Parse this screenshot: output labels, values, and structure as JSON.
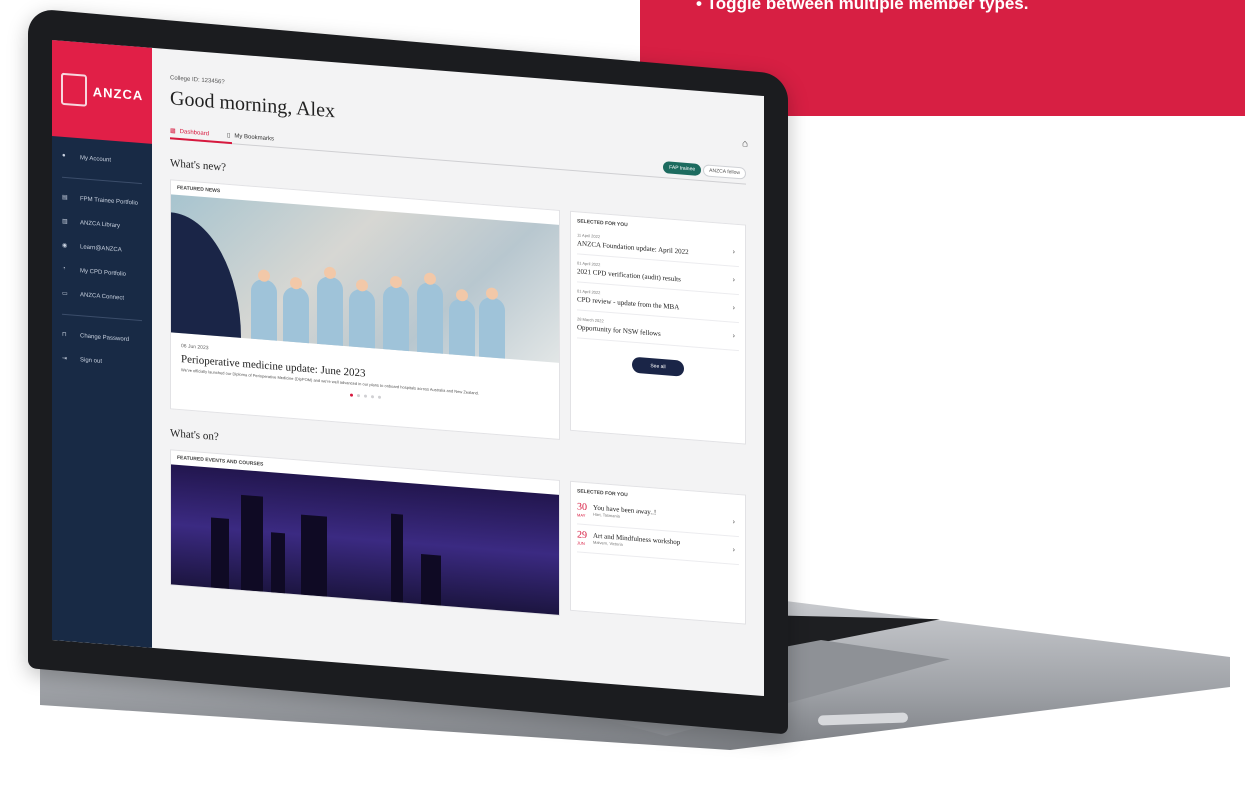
{
  "banner": {
    "bullet": "• Toggle between multiple member types."
  },
  "sidebar": {
    "brand": "ANZCA",
    "items": [
      {
        "label": "My Account",
        "icon": "user-icon"
      },
      {
        "label": "FPM Trainee Portfolio",
        "icon": "portfolio-icon"
      },
      {
        "label": "ANZCA Library",
        "icon": "library-icon"
      },
      {
        "label": "Learn@ANZCA",
        "icon": "learn-icon"
      },
      {
        "label": "My CPD Portfolio",
        "icon": "cpd-icon"
      },
      {
        "label": "ANZCA Connect",
        "icon": "connect-icon"
      },
      {
        "label": "Change Password",
        "icon": "lock-icon"
      },
      {
        "label": "Sign out",
        "icon": "signout-icon"
      }
    ]
  },
  "header": {
    "college_id": "College ID: 123456?",
    "greeting": "Good morning, Alex",
    "tabs": [
      {
        "label": "Dashboard"
      },
      {
        "label": "My Bookmarks"
      }
    ],
    "toggle": [
      "FAP trainee",
      "ANZCA fellow"
    ]
  },
  "whats_new": {
    "title": "What's new?",
    "featured_label": "FEATURED NEWS",
    "news": {
      "date": "06 Jun 2023",
      "title": "Perioperative medicine update: June 2023",
      "body": "We've officially launched our Diploma of Perioperative Medicine (DipPOM) and we're well advanced in our plans to onboard hospitals across Australia and New Zealand."
    },
    "selected_label": "SELECTED FOR YOU",
    "list": [
      {
        "date": "11 April 2022",
        "title": "ANZCA Foundation update: April 2022"
      },
      {
        "date": "01 April 2022",
        "title": "2021 CPD verification (audit) results"
      },
      {
        "date": "01 April 2022",
        "title": "CPD review - update from the MBA"
      },
      {
        "date": "28 March 2022",
        "title": "Opportunity for NSW fellows"
      }
    ],
    "see_all": "See all"
  },
  "whats_on": {
    "title": "What's on?",
    "featured_label": "FEATURED EVENTS AND COURSES",
    "selected_label": "SELECTED FOR YOU",
    "events": [
      {
        "day": "30",
        "month": "MAY",
        "title": "You have been away..!",
        "location": "Hart, Tasmania"
      },
      {
        "day": "29",
        "month": "JUN",
        "title": "Art and Mindfulness workshop",
        "location": "Malvern, Victoria"
      }
    ]
  },
  "colors": {
    "brand_red": "#e11f47",
    "navy": "#182a45",
    "accent": "#d7183e"
  }
}
